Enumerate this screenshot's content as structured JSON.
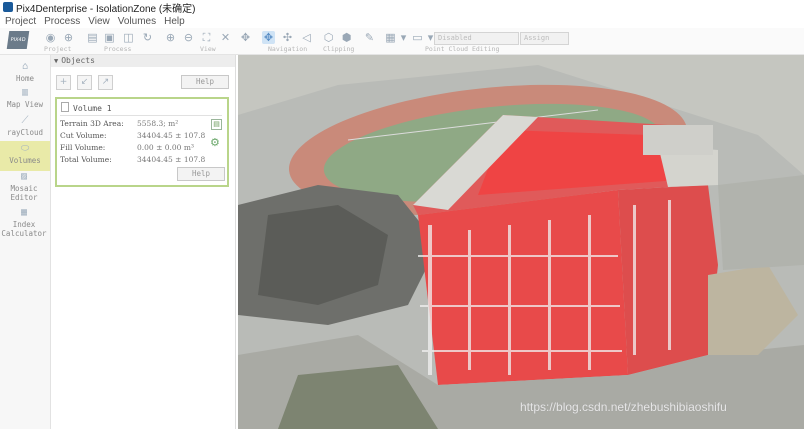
{
  "window": {
    "title": "Pix4Denterprise - IsolationZone (未确定)"
  },
  "menu": [
    "Project",
    "Process",
    "View",
    "Volumes",
    "Help"
  ],
  "toolbar": {
    "logo": "PIX4D",
    "groups": [
      "Project",
      "Process",
      "View",
      "Navigation",
      "Clipping",
      "Point Cloud Editing"
    ],
    "dropdown_value": "Disabled",
    "dropdown2_value": "Assign"
  },
  "sidebar": {
    "items": [
      {
        "label": "Home",
        "icon": "home-icon"
      },
      {
        "label": "Map View",
        "icon": "map-icon"
      },
      {
        "label": "rayCloud",
        "icon": "raycloud-icon"
      },
      {
        "label": "Volumes",
        "icon": "volumes-icon",
        "active": true
      },
      {
        "label": "Mosaic Editor",
        "icon": "mosaic-icon"
      },
      {
        "label": "Index Calculator",
        "icon": "index-calculator-icon"
      }
    ]
  },
  "objects_panel": {
    "header": "Objects",
    "help_label": "Help",
    "volume": {
      "title": "Volume 1",
      "rows": [
        {
          "key": "Terrain 3D Area:",
          "value": "5558.3; m²"
        },
        {
          "key": "Cut Volume:",
          "value": "34404.45 ± 107.8"
        },
        {
          "key": "Fill Volume:",
          "value": "0.00 ± 0.00 m³"
        },
        {
          "key": "Total Volume:",
          "value": "34404.45 ± 107.8"
        }
      ],
      "help_label": "Help"
    }
  },
  "watermark": "https://blog.csdn.net/zhebushibiaoshifu",
  "colors": {
    "active_side": "#e9eaa8",
    "volume_border": "#b9d58a",
    "building_red": "#e84a4a",
    "track_red": "#c98a7a",
    "grass": "#8fa985"
  }
}
